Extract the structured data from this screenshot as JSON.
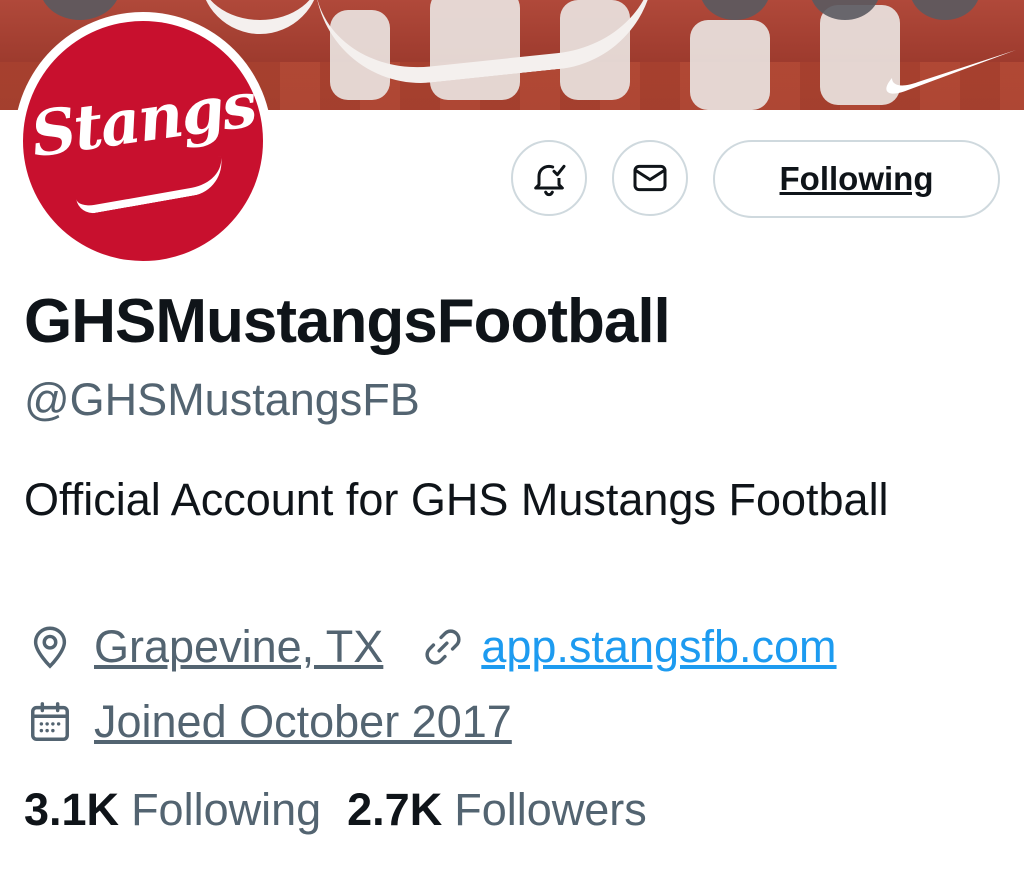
{
  "banner": {
    "brand_icon": "nike-swoosh",
    "accent": "#b0493a"
  },
  "avatar": {
    "logo_text": "Stangs",
    "background": "#c8102e"
  },
  "actions": {
    "notify_icon": "bell-check-icon",
    "message_icon": "envelope-icon",
    "follow_label": "Following"
  },
  "profile": {
    "display_name": "GHSMustangsFootball",
    "handle": "@GHSMustangsFB",
    "bio": "Official Account for GHS Mustangs Football",
    "location": "Grapevine, TX",
    "website": "app.stangsfb.com",
    "joined": "Joined October 2017"
  },
  "stats": {
    "following_count": "3.1K",
    "following_label": "Following",
    "followers_count": "2.7K",
    "followers_label": "Followers"
  },
  "colors": {
    "text": "#0f1419",
    "muted": "#536471",
    "link": "#1d9bf0",
    "border": "#cfd9de"
  }
}
